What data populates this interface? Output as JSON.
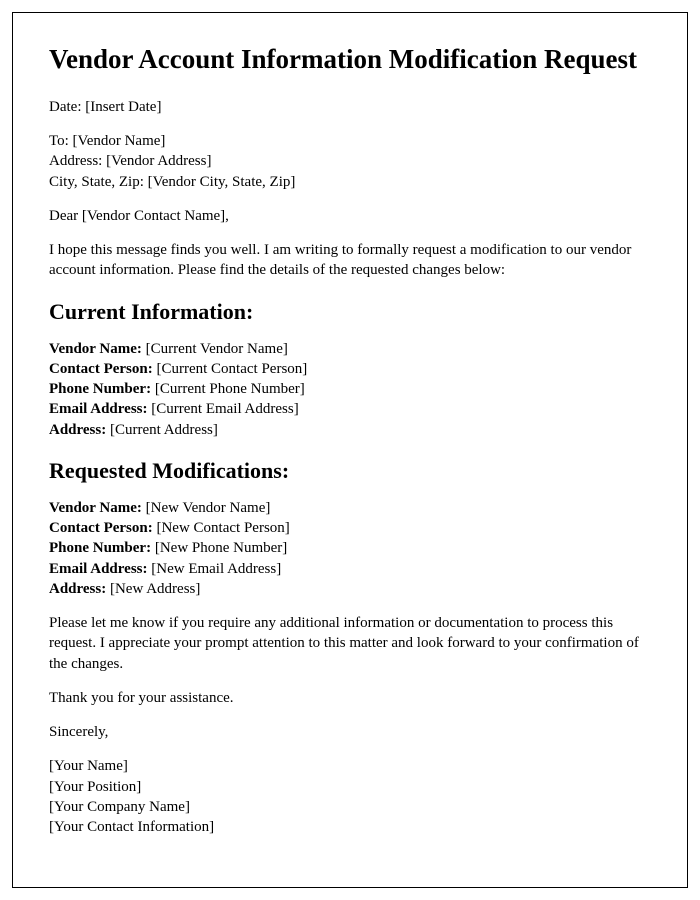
{
  "title": "Vendor Account Information Modification Request",
  "dateLine": "Date: [Insert Date]",
  "recipient": {
    "to": "To: [Vendor Name]",
    "address": "Address: [Vendor Address]",
    "cityStateZip": "City, State, Zip: [Vendor City, State, Zip]"
  },
  "salutation": "Dear [Vendor Contact Name],",
  "intro": "I hope this message finds you well. I am writing to formally request a modification to our vendor account information. Please find the details of the requested changes below:",
  "currentHeading": "Current Information:",
  "current": {
    "vendorName": {
      "label": "Vendor Name:",
      "value": " [Current Vendor Name]"
    },
    "contactPerson": {
      "label": "Contact Person:",
      "value": " [Current Contact Person]"
    },
    "phone": {
      "label": "Phone Number:",
      "value": " [Current Phone Number]"
    },
    "email": {
      "label": "Email Address:",
      "value": " [Current Email Address]"
    },
    "address": {
      "label": "Address:",
      "value": " [Current Address]"
    }
  },
  "requestedHeading": "Requested Modifications:",
  "requested": {
    "vendorName": {
      "label": "Vendor Name:",
      "value": " [New Vendor Name]"
    },
    "contactPerson": {
      "label": "Contact Person:",
      "value": " [New Contact Person]"
    },
    "phone": {
      "label": "Phone Number:",
      "value": " [New Phone Number]"
    },
    "email": {
      "label": "Email Address:",
      "value": " [New Email Address]"
    },
    "address": {
      "label": "Address:",
      "value": " [New Address]"
    }
  },
  "closing1": "Please let me know if you require any additional information or documentation to process this request. I appreciate your prompt attention to this matter and look forward to your confirmation of the changes.",
  "closing2": "Thank you for your assistance.",
  "signoff": "Sincerely,",
  "signature": {
    "name": "[Your Name]",
    "position": "[Your Position]",
    "company": "[Your Company Name]",
    "contact": "[Your Contact Information]"
  }
}
